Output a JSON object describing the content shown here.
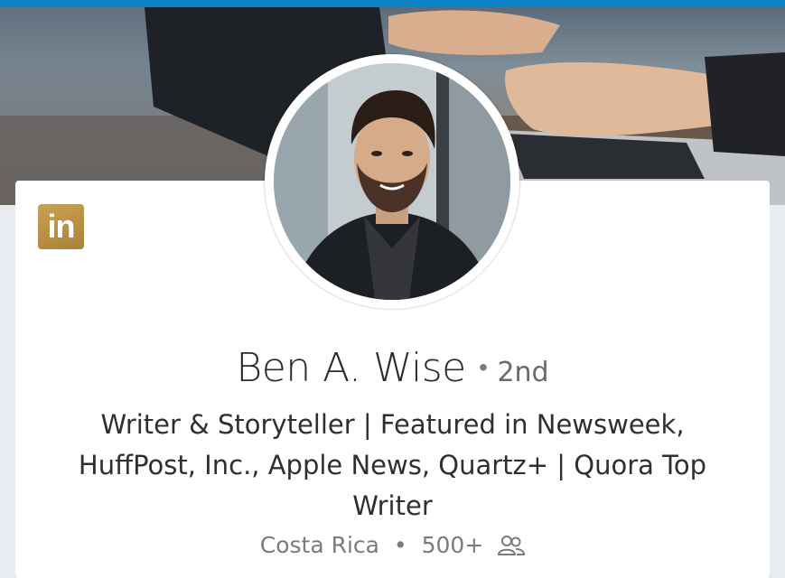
{
  "profile": {
    "name": "Ben A. Wise",
    "separator": "•",
    "connection_degree": "2nd",
    "headline": "Writer & Storyteller | Featured in Newsweek, HuffPost, Inc., Apple News, Quartz+ | Quora Top Writer",
    "location": "Costa Rica",
    "connections": "500+",
    "badge_text": "in"
  },
  "colors": {
    "top_bar": "#0a82c6",
    "badge": "#b8914a",
    "background": "#e9ecee",
    "card": "#ffffff"
  },
  "icons": {
    "connections": "connections-icon",
    "linkedin": "linkedin-logo-icon"
  }
}
